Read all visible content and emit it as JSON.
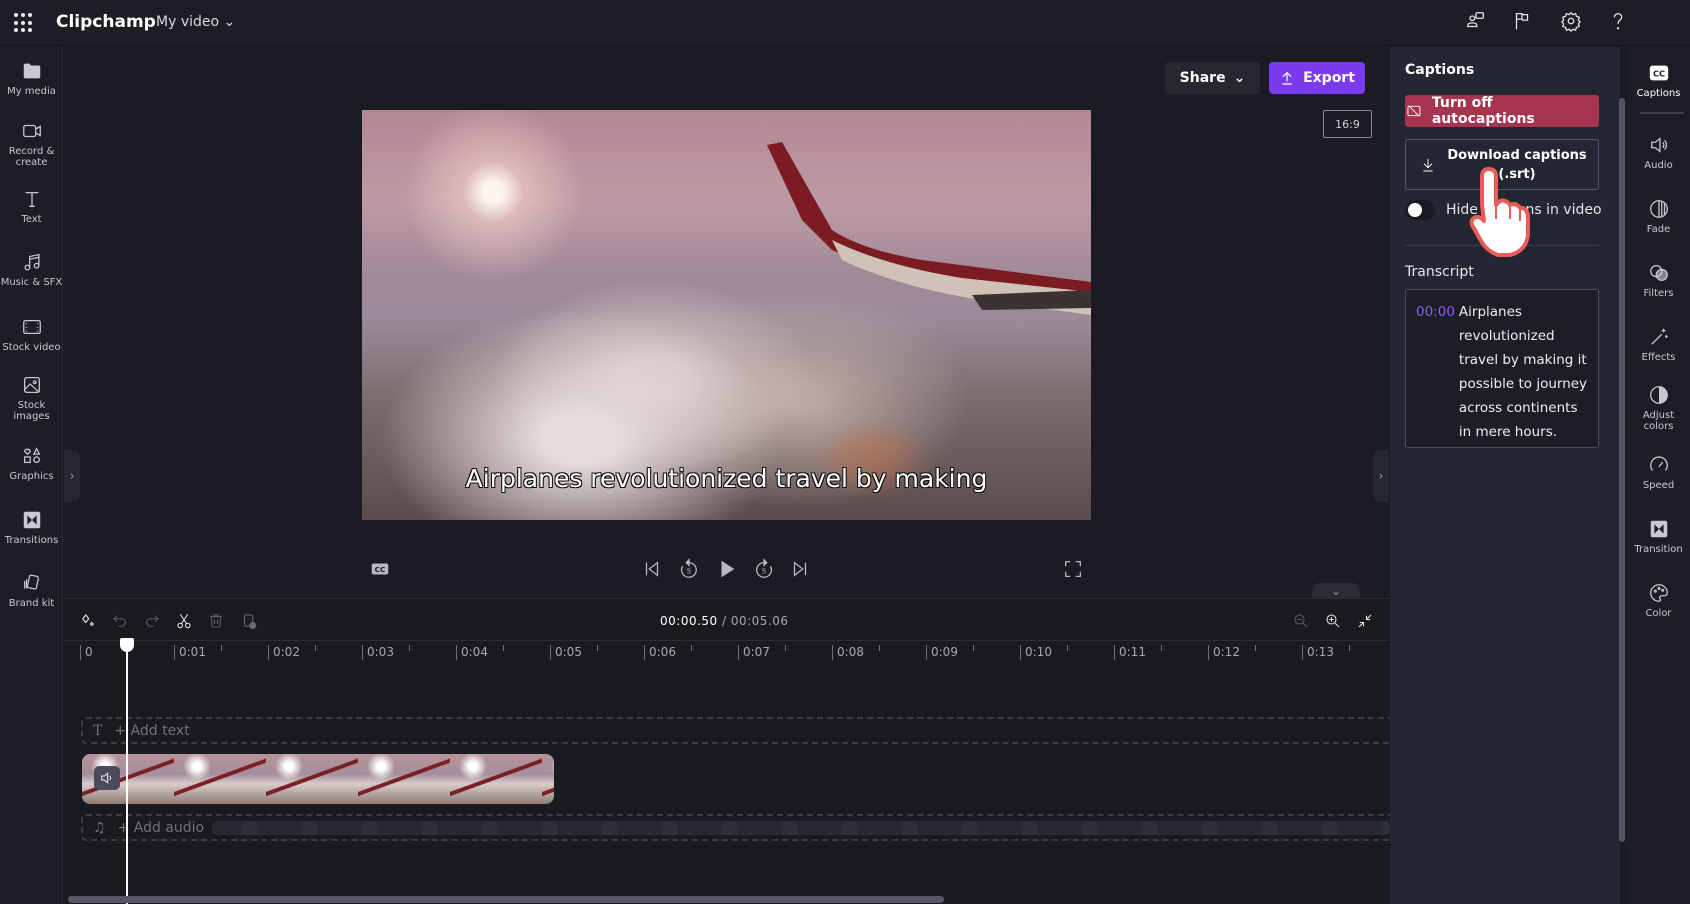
{
  "app": {
    "title": "Clipchamp",
    "project_name": "My video"
  },
  "topbar": {
    "icons": [
      "waffle-icon",
      "feedback-icon",
      "flag-icon",
      "settings-icon",
      "help-icon"
    ]
  },
  "left_nav": [
    {
      "label": "My media",
      "icon": "folder-icon"
    },
    {
      "label": "Record & create",
      "icon": "camera-icon"
    },
    {
      "label": "Text",
      "icon": "text-icon"
    },
    {
      "label": "Music & SFX",
      "icon": "music-icon"
    },
    {
      "label": "Stock video",
      "icon": "film-icon"
    },
    {
      "label": "Stock images",
      "icon": "image-icon"
    },
    {
      "label": "Graphics",
      "icon": "shapes-icon"
    },
    {
      "label": "Transitions",
      "icon": "transition-icon"
    },
    {
      "label": "Brand kit",
      "icon": "brand-kit-icon"
    }
  ],
  "preview": {
    "share_label": "Share",
    "export_label": "Export",
    "aspect_ratio": "16:9",
    "subtitle": "Airplanes revolutionized travel by making",
    "accent": "#7c3aed"
  },
  "timeline": {
    "current_time": "00:00.50",
    "total_time": "00:05.06",
    "separator": " / ",
    "ruler": [
      "0",
      "0:01",
      "0:02",
      "0:03",
      "0:04",
      "0:05",
      "0:06",
      "0:07",
      "0:08",
      "0:09",
      "0:10",
      "0:11",
      "0:12",
      "0:13"
    ],
    "add_text": "+ Add text",
    "add_audio": "+ Add audio"
  },
  "captions_panel": {
    "title": "Captions",
    "autocaptions_button": "Turn off autocaptions",
    "download_line1": "Download captions",
    "download_line2": "(.srt)",
    "hide_label": "Hide captions in video",
    "hide_enabled": false,
    "transcript_title": "Transcript",
    "transcript": [
      {
        "time": "00:00",
        "text": "Airplanes revolutionized travel by making it possible to journey across continents in mere hours."
      }
    ],
    "autocaptions_color": "#a5354f"
  },
  "right_nav": [
    {
      "label": "Captions",
      "icon": "cc-icon"
    },
    {
      "label": "Audio",
      "icon": "speaker-icon"
    },
    {
      "label": "Fade",
      "icon": "fade-icon"
    },
    {
      "label": "Filters",
      "icon": "filters-icon"
    },
    {
      "label": "Effects",
      "icon": "magic-wand-icon"
    },
    {
      "label": "Adjust colors",
      "icon": "contrast-icon"
    },
    {
      "label": "Speed",
      "icon": "speedometer-icon"
    },
    {
      "label": "Transition",
      "icon": "transition-icon"
    },
    {
      "label": "Color",
      "icon": "palette-icon"
    }
  ]
}
